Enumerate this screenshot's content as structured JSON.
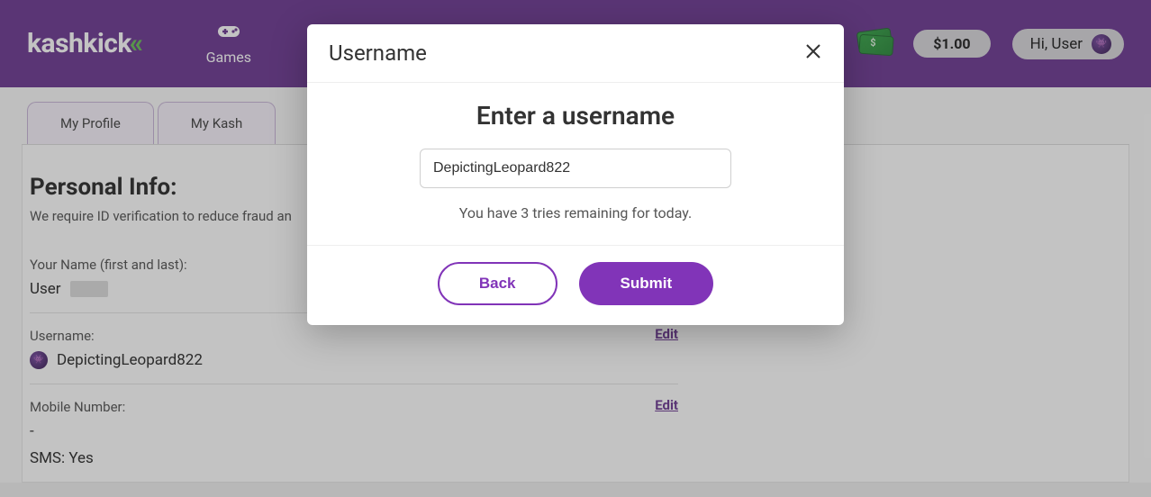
{
  "brand": {
    "name": "kashkick",
    "accent_glyph": "«"
  },
  "nav": {
    "games": "Games"
  },
  "header": {
    "balance": "$1.00",
    "greeting": "Hi, User"
  },
  "tabs": {
    "profile": "My Profile",
    "kash": "My Kash"
  },
  "profile": {
    "section_title": "Personal Info:",
    "section_sub": "We require ID verification to reduce fraud an",
    "name_label": "Your Name (first and last):",
    "name_value_prefix": "User",
    "username_label": "Username:",
    "username_value": "DepictingLeopard822",
    "mobile_label": "Mobile Number:",
    "mobile_value": "-",
    "sms_line": "SMS: Yes",
    "edit": "Edit"
  },
  "modal": {
    "title": "Username",
    "heading": "Enter a username",
    "input_value": "DepictingLeopard822",
    "tries_text": "You have 3 tries remaining for today.",
    "back": "Back",
    "submit": "Submit"
  }
}
